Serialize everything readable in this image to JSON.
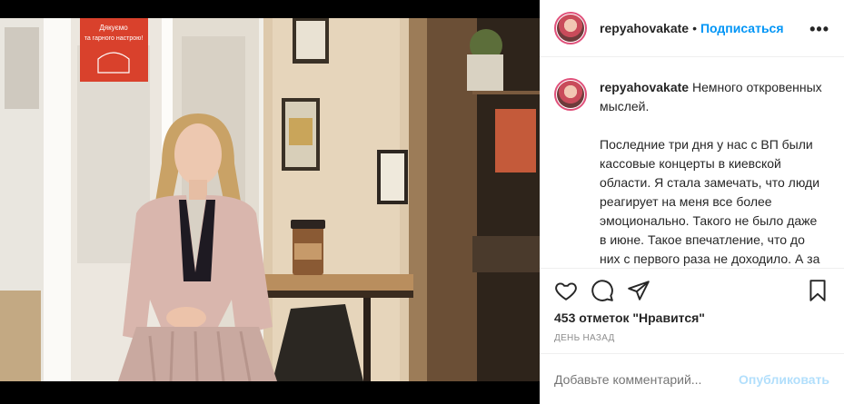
{
  "photo": {
    "sign_text": "Дякуємо\nта гарного настрою!"
  },
  "header": {
    "username": "repyahovakate",
    "separator": "•",
    "follow_label": "Подписаться",
    "more_label": "•••"
  },
  "caption": {
    "username": "repyahovakate",
    "text": "Немного откровенных мыслей.\n\nПоследние три дня у нас с ВП были кассовые концерты в киевской области. Я стала замечать, что люди реагирует на меня все более эмоционально. Такого не было даже в июне. Такое впечатление, что до них с первого раза не доходило. А за пол года каналы настолько"
  },
  "actions": {
    "like_icon": "heart-icon",
    "comment_icon": "comment-icon",
    "share_icon": "share-icon",
    "save_icon": "bookmark-icon"
  },
  "likes_text": "453 отметок \"Нравится\"",
  "time_text": "ДЕНЬ НАЗАД",
  "add_comment": {
    "placeholder": "Добавьте комментарий...",
    "post_label": "Опубликовать"
  }
}
